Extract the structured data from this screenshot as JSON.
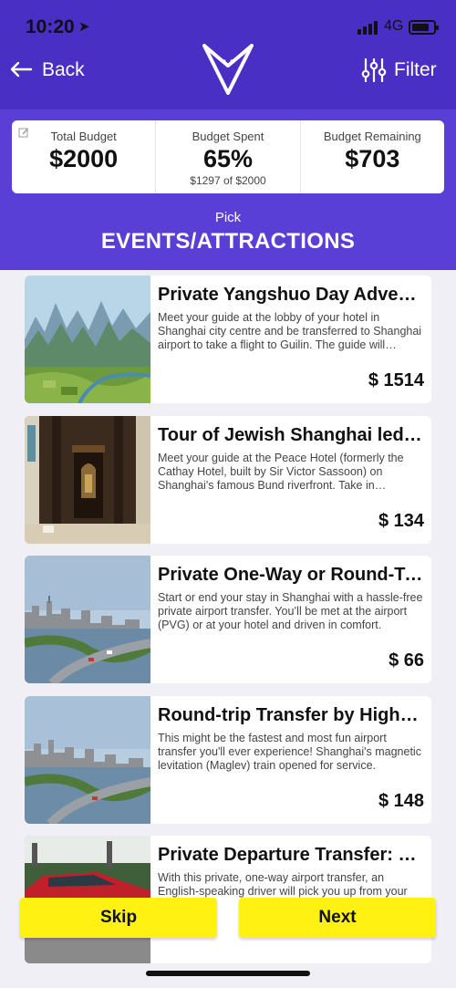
{
  "status": {
    "time": "10:20",
    "network": "4G"
  },
  "nav": {
    "back_label": "Back",
    "filter_label": "Filter"
  },
  "budget": {
    "total_label": "Total Budget",
    "total_value": "$2000",
    "spent_label": "Budget Spent",
    "spent_value": "65%",
    "spent_sub": "$1297 of $2000",
    "remaining_label": "Budget Remaining",
    "remaining_value": "$703"
  },
  "section": {
    "pick": "Pick",
    "title": "EVENTS/ATTRACTIONS"
  },
  "items": [
    {
      "title": "Private Yangshuo Day Adventure from Shanghai",
      "desc": "Meet your guide at the lobby of your hotel in Shanghai city centre and be transferred to Shanghai airport to take a flight to Guilin. The guide will accompany you.",
      "price": "$ 1514",
      "image": "karst-landscape"
    },
    {
      "title": "Tour of Jewish Shanghai led by a local guide",
      "desc": "Meet your guide at the Peace Hotel (formerly the Cathay Hotel, built by Sir Victor Sassoon) on Shanghai's famous Bund riverfront. Take in magnificent views.",
      "price": "$ 134",
      "image": "synagogue-interior"
    },
    {
      "title": "Private One-Way or Round-Trip Airport Transfer",
      "desc": "Start or end your stay in Shanghai with a hassle-free private airport transfer. You’ll be met at the airport (PVG) or at your hotel and driven in comfort.",
      "price": "$ 66",
      "image": "bund-skyline"
    },
    {
      "title": "Round-trip Transfer by High-speed Maglev Train",
      "desc": "This might be the fastest and most fun airport transfer you'll ever experience! Shanghai's magnetic levitation (Maglev) train opened for service.",
      "price": "$ 148",
      "image": "bund-skyline"
    },
    {
      "title": "Private Departure Transfer: Hotel to Airport",
      "desc": "With this private, one-way airport transfer, an English-speaking driver will pick you up from your hotel",
      "price": "",
      "image": "red-car"
    }
  ],
  "actions": {
    "skip_label": "Skip",
    "next_label": "Next"
  },
  "colors": {
    "header": "#5a3fd6",
    "header_dark": "#4a2fc4",
    "button": "#fff112",
    "background": "#efeff5"
  }
}
